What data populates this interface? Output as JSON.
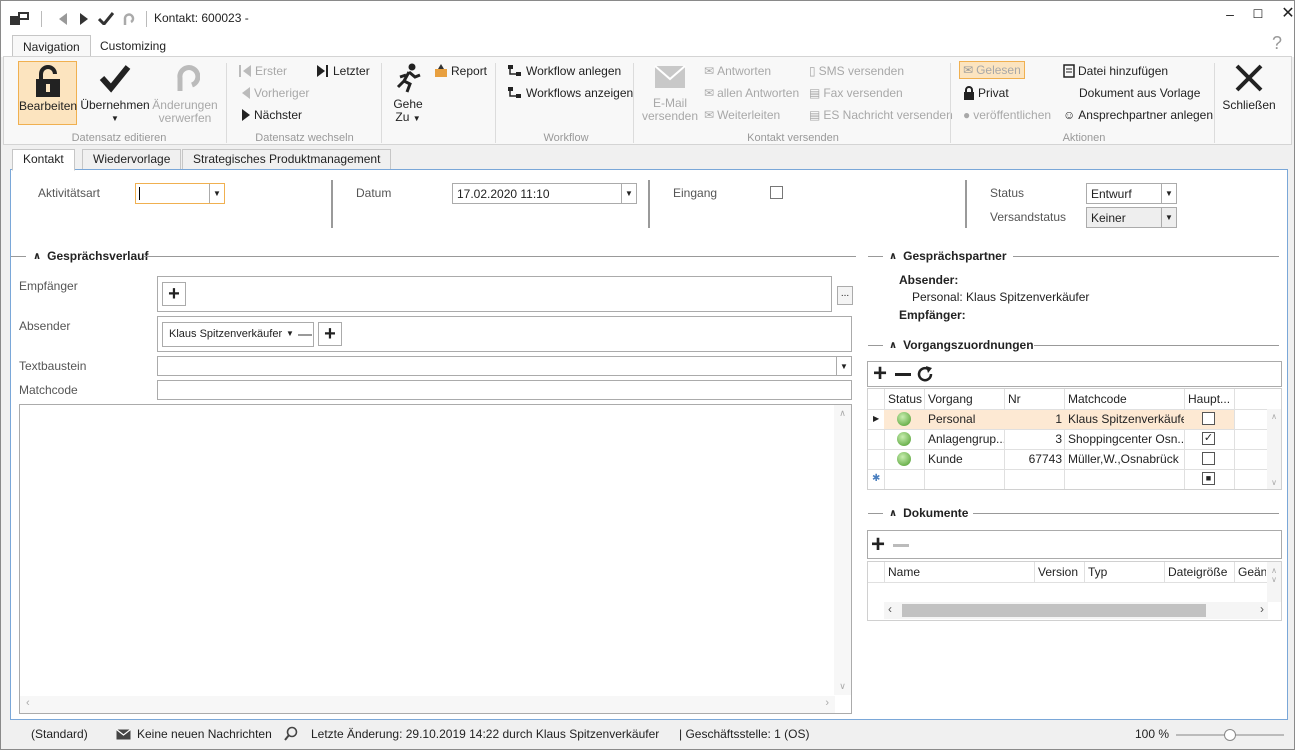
{
  "window": {
    "title": "Kontakt: 600023 -"
  },
  "ribbon_tabs": [
    "Navigation",
    "Customizing"
  ],
  "ribbon": {
    "datensatz_editieren": {
      "label": "Datensatz editieren",
      "bearbeiten": "Bearbeiten",
      "uebernehmen": "Übernehmen",
      "aenderungen1": "Änderungen",
      "aenderungen2": "verwerfen"
    },
    "datensatz_wechseln": {
      "label": "Datensatz wechseln",
      "erster": "Erster",
      "vorheriger": "Vorheriger",
      "naechster": "Nächster",
      "letzter": "Letzter"
    },
    "gehe": {
      "gehe": "Gehe",
      "zu": "Zu",
      "report": "Report"
    },
    "workflow": {
      "label": "Workflow",
      "anlegen": "Workflow anlegen",
      "anzeigen": "Workflows anzeigen"
    },
    "kontakt_versenden": {
      "label": "Kontakt versenden",
      "email1": "E-Mail",
      "email2": "versenden",
      "antworten": "Antworten",
      "allen_antworten": "allen Antworten",
      "weiterleiten": "Weiterleiten",
      "sms": "SMS versenden",
      "fax": "Fax versenden",
      "es": "ES Nachricht versenden"
    },
    "aktionen": {
      "label": "Aktionen",
      "gelesen": "Gelesen",
      "privat": "Privat",
      "veroeffentlichen": "veröffentlichen",
      "datei": "Datei hinzufügen",
      "dokument": "Dokument aus Vorlage",
      "ansprechpartner": "Ansprechpartner anlegen"
    },
    "schliessen": "Schließen"
  },
  "doc_tabs": [
    "Kontakt",
    "Wiedervorlage",
    "Strategisches Produktmanagement"
  ],
  "form": {
    "aktivitaetsart_label": "Aktivitätsart",
    "aktivitaetsart_value": "",
    "datum_label": "Datum",
    "datum_value": "17.02.2020 11:10",
    "eingang_label": "Eingang",
    "status_label": "Status",
    "status_value": "Entwurf",
    "versandstatus_label": "Versandstatus",
    "versandstatus_value": "Keiner"
  },
  "gespraechsverlauf": {
    "title": "Gesprächsverlauf",
    "empfaenger_label": "Empfänger",
    "absender_label": "Absender",
    "absender_value": "Klaus Spitzenverkäufer",
    "textbaustein_label": "Textbaustein",
    "matchcode_label": "Matchcode",
    "ellipsis": "..."
  },
  "gespraechspartner": {
    "title": "Gesprächspartner",
    "absender_label": "Absender:",
    "absender_value": "Personal: Klaus Spitzenverkäufer",
    "empfaenger_label": "Empfänger:"
  },
  "vorgangszuordnungen": {
    "title": "Vorgangszuordnungen",
    "columns": [
      "Status",
      "Vorgang",
      "Nr",
      "Matchcode",
      "Haupt..."
    ],
    "rows": [
      {
        "vorgang": "Personal",
        "nr": "1",
        "matchcode": "Klaus Spitzenverkäufer",
        "haupt": false
      },
      {
        "vorgang": "Anlagengrup...",
        "nr": "3",
        "matchcode": "Shoppingcenter Osn...",
        "haupt": true
      },
      {
        "vorgang": "Kunde",
        "nr": "67743",
        "matchcode": "Müller,W.,Osnabrück",
        "haupt": false
      }
    ]
  },
  "dokumente": {
    "title": "Dokumente",
    "columns": [
      "Name",
      "Version",
      "Typ",
      "Dateigröße",
      "Geän"
    ]
  },
  "statusbar": {
    "standard": "(Standard)",
    "nachrichten": "Keine neuen Nachrichten",
    "letzte_aenderung": "Letzte Änderung: 29.10.2019 14:22 durch Klaus Spitzenverkäufer",
    "geschaeftsstelle": "| Geschäftsstelle:  1 (OS)",
    "zoom": "100 %",
    "zoom_level": 0.5
  },
  "colors": {
    "accent": "#7aa7d8",
    "highlight": "#fce4bf",
    "selected_row": "#fde9d3"
  }
}
